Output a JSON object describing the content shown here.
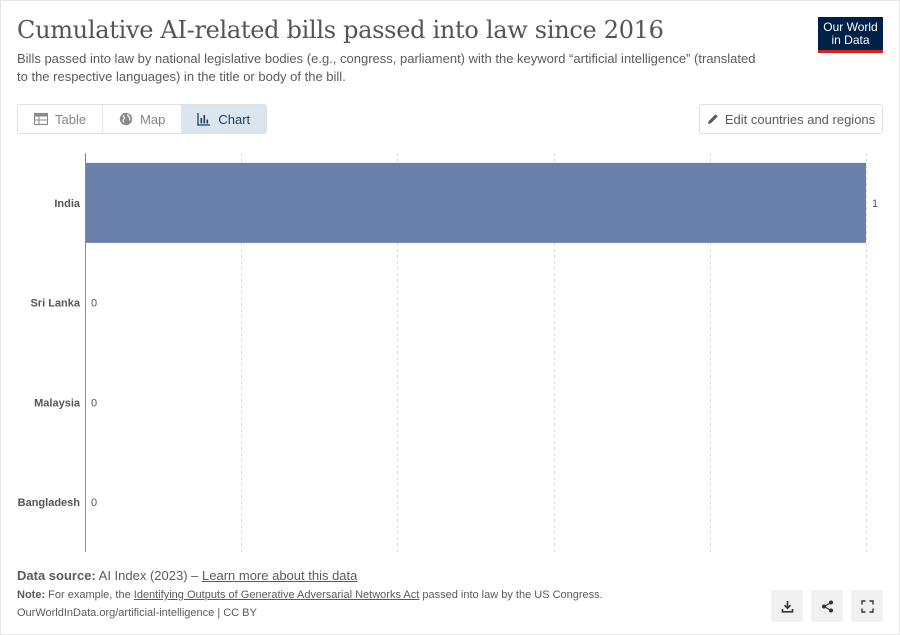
{
  "header": {
    "title": "Cumulative AI-related bills passed into law since 2016",
    "subtitle": "Bills passed into law by national legislative bodies (e.g., congress, parliament) with the keyword “artificial intelligence” (translated to the respective languages) in the title or body of the bill."
  },
  "logo": {
    "line1": "Our World",
    "line2": "in Data"
  },
  "tabs": [
    {
      "label": "Table",
      "icon": "table-icon",
      "active": false
    },
    {
      "label": "Map",
      "icon": "globe-icon",
      "active": false
    },
    {
      "label": "Chart",
      "icon": "chart-icon",
      "active": true
    }
  ],
  "edit_button": {
    "label": "Edit countries and regions",
    "icon": "pencil-icon"
  },
  "chart_data": {
    "type": "bar",
    "orientation": "horizontal",
    "categories": [
      "India",
      "Sri Lanka",
      "Malaysia",
      "Bangladesh"
    ],
    "values": [
      1,
      0,
      0,
      0
    ],
    "xlim": [
      0,
      1
    ],
    "grid": true,
    "bar_color": "#6981ab"
  },
  "footer": {
    "source_label": "Data source:",
    "source_text": "AI Index (2023) – ",
    "source_link": "Learn more about this data",
    "note_label": "Note:",
    "note_prefix": " For example, the ",
    "note_link": "Identifying Outputs of Generative Adversarial Networks Act",
    "note_suffix": " passed into law by the US Congress.",
    "url": "OurWorldInData.org/artificial-intelligence | CC BY"
  },
  "actions": [
    {
      "name": "download-button",
      "icon": "download-icon"
    },
    {
      "name": "share-button",
      "icon": "share-icon"
    },
    {
      "name": "fullscreen-button",
      "icon": "fullscreen-icon"
    }
  ]
}
